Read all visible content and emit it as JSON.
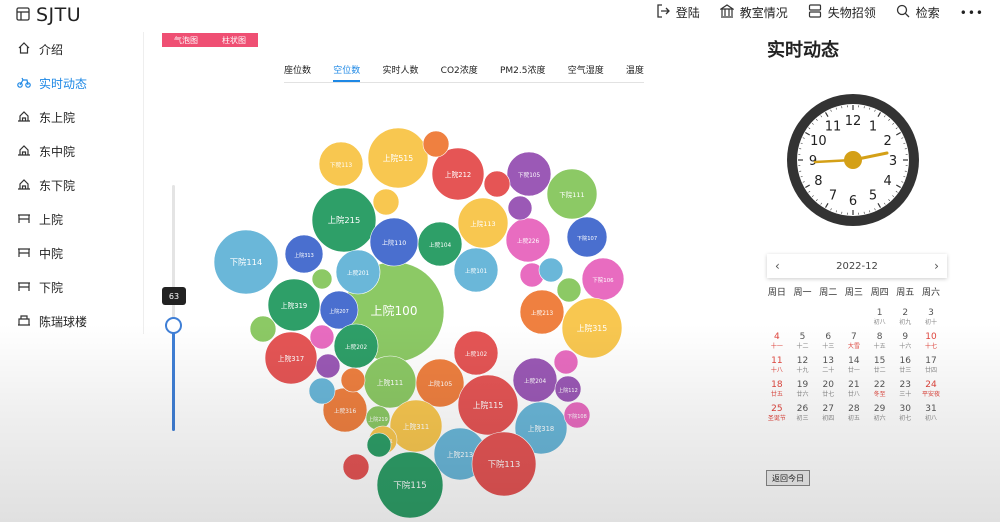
{
  "header": {
    "title": "SJTU",
    "nav": [
      {
        "icon": "logout-icon",
        "label": "登陆"
      },
      {
        "icon": "bank-icon",
        "label": "教室情况"
      },
      {
        "icon": "server-icon",
        "label": "失物招领"
      },
      {
        "icon": "search-icon",
        "label": "检索"
      }
    ],
    "more_icon": "ellipsis-icon"
  },
  "sidebar": {
    "items": [
      {
        "icon": "home-icon",
        "label": "介绍"
      },
      {
        "icon": "bike-icon",
        "label": "实时动态",
        "active": true
      },
      {
        "icon": "building-icon",
        "label": "东上院"
      },
      {
        "icon": "building-icon",
        "label": "东中院"
      },
      {
        "icon": "building-icon",
        "label": "东下院"
      },
      {
        "icon": "desk-icon",
        "label": "上院"
      },
      {
        "icon": "desk-icon",
        "label": "中院"
      },
      {
        "icon": "desk-icon",
        "label": "下院"
      },
      {
        "icon": "stadium-icon",
        "label": "陈瑞球楼"
      }
    ]
  },
  "view_tabs": [
    "气泡图",
    "柱状图"
  ],
  "metric_tabs": {
    "items": [
      "座位数",
      "空位数",
      "实时人数",
      "CO2浓度",
      "PM2.5浓度",
      "空气湿度",
      "温度"
    ],
    "active": 1
  },
  "slider": {
    "value": "63",
    "level": 0.3
  },
  "chart_data": {
    "type": "bubble",
    "bubbles": [
      {
        "label": "上院100",
        "color": "#8cc965"
      },
      {
        "label": "下院114",
        "color": "#6ab7d9"
      },
      {
        "label": "上院215",
        "color": "#2e9f68"
      },
      {
        "label": "上院515",
        "color": "#f8c750"
      },
      {
        "label": "下院113",
        "color": "#f8c750"
      },
      {
        "label": "上院212",
        "color": "#e55555"
      },
      {
        "label": "下院105",
        "color": "#9b59b6"
      },
      {
        "label": "下院111",
        "color": "#8cc965"
      },
      {
        "label": "上院110",
        "color": "#4a6fcf"
      },
      {
        "label": "上院104",
        "color": "#2e9f68"
      },
      {
        "label": "上院113",
        "color": "#f8c750"
      },
      {
        "label": "上院226",
        "color": "#e86cc0"
      },
      {
        "label": "下院107",
        "color": "#4a6fcf"
      },
      {
        "label": "上院201",
        "color": "#6ab7d9"
      },
      {
        "label": "上院313",
        "color": "#4a6fcf"
      },
      {
        "label": "下院106",
        "color": "#e86cc0"
      },
      {
        "label": "上院319",
        "color": "#2e9f68"
      },
      {
        "label": "上院207",
        "color": "#4a6fcf"
      },
      {
        "label": "上院101",
        "color": "#6ab7d9"
      },
      {
        "label": "上院213",
        "color": "#ef8040"
      },
      {
        "label": "上院315",
        "color": "#f8c750"
      },
      {
        "label": "上院317",
        "color": "#e55555"
      },
      {
        "label": "上院202",
        "color": "#2e9f68"
      },
      {
        "label": "上院111",
        "color": "#8cc965"
      },
      {
        "label": "上院105",
        "color": "#ef8040"
      },
      {
        "label": "上院102",
        "color": "#e55555"
      },
      {
        "label": "上院204",
        "color": "#9b59b6"
      },
      {
        "label": "上院115",
        "color": "#e55555"
      },
      {
        "label": "上院311",
        "color": "#f8c750"
      },
      {
        "label": "上院318",
        "color": "#6ab7d9"
      },
      {
        "label": "上院213",
        "color": "#6ab7d9"
      },
      {
        "label": "下院113",
        "color": "#e55555"
      },
      {
        "label": "下院115",
        "color": "#2e9f68"
      },
      {
        "label": "上院316",
        "color": "#ef8040"
      },
      {
        "label": "上院219",
        "color": "#8cc965"
      },
      {
        "label": "上院211",
        "color": "#f8c750"
      },
      {
        "label": "上院112",
        "color": "#9b59b6"
      },
      {
        "label": "下院108",
        "color": "#e86cc0"
      }
    ]
  },
  "right_panel": {
    "title": "实时动态",
    "clock": {
      "numbers": [
        "12",
        "1",
        "2",
        "3",
        "4",
        "5",
        "6",
        "7",
        "8",
        "9",
        "10",
        "11"
      ]
    },
    "calendar": {
      "month": "2022-12",
      "weekdays": [
        "周日",
        "周一",
        "周二",
        "周三",
        "周四",
        "周五",
        "周六"
      ],
      "days": [
        [
          "",
          "",
          ""
        ],
        [
          "",
          "",
          ""
        ],
        [
          "",
          "",
          ""
        ],
        [
          "",
          "",
          ""
        ],
        [
          "1",
          "初八",
          ""
        ],
        [
          "2",
          "初九",
          ""
        ],
        [
          "3",
          "初十",
          ""
        ],
        [
          "4",
          "十一",
          "red"
        ],
        [
          "5",
          "十二",
          ""
        ],
        [
          "6",
          "十三",
          ""
        ],
        [
          "7",
          "大雪",
          "redsub"
        ],
        [
          "8",
          "十五",
          ""
        ],
        [
          "9",
          "十六",
          ""
        ],
        [
          "10",
          "十七",
          "red"
        ],
        [
          "11",
          "十八",
          "red"
        ],
        [
          "12",
          "十九",
          ""
        ],
        [
          "13",
          "二十",
          ""
        ],
        [
          "14",
          "廿一",
          ""
        ],
        [
          "15",
          "廿二",
          ""
        ],
        [
          "16",
          "廿三",
          ""
        ],
        [
          "17",
          "廿四",
          ""
        ],
        [
          "18",
          "廿五",
          "red"
        ],
        [
          "19",
          "廿六",
          ""
        ],
        [
          "20",
          "廿七",
          ""
        ],
        [
          "21",
          "廿八",
          ""
        ],
        [
          "22",
          "冬至",
          "redsub"
        ],
        [
          "23",
          "三十",
          ""
        ],
        [
          "24",
          "平安夜",
          "red"
        ],
        [
          "25",
          "圣诞节",
          "red"
        ],
        [
          "26",
          "初三",
          ""
        ],
        [
          "27",
          "初四",
          ""
        ],
        [
          "28",
          "初五",
          ""
        ],
        [
          "29",
          "初六",
          ""
        ],
        [
          "30",
          "初七",
          ""
        ],
        [
          "31",
          "初八",
          ""
        ]
      ]
    },
    "today_button": "返回今日"
  }
}
